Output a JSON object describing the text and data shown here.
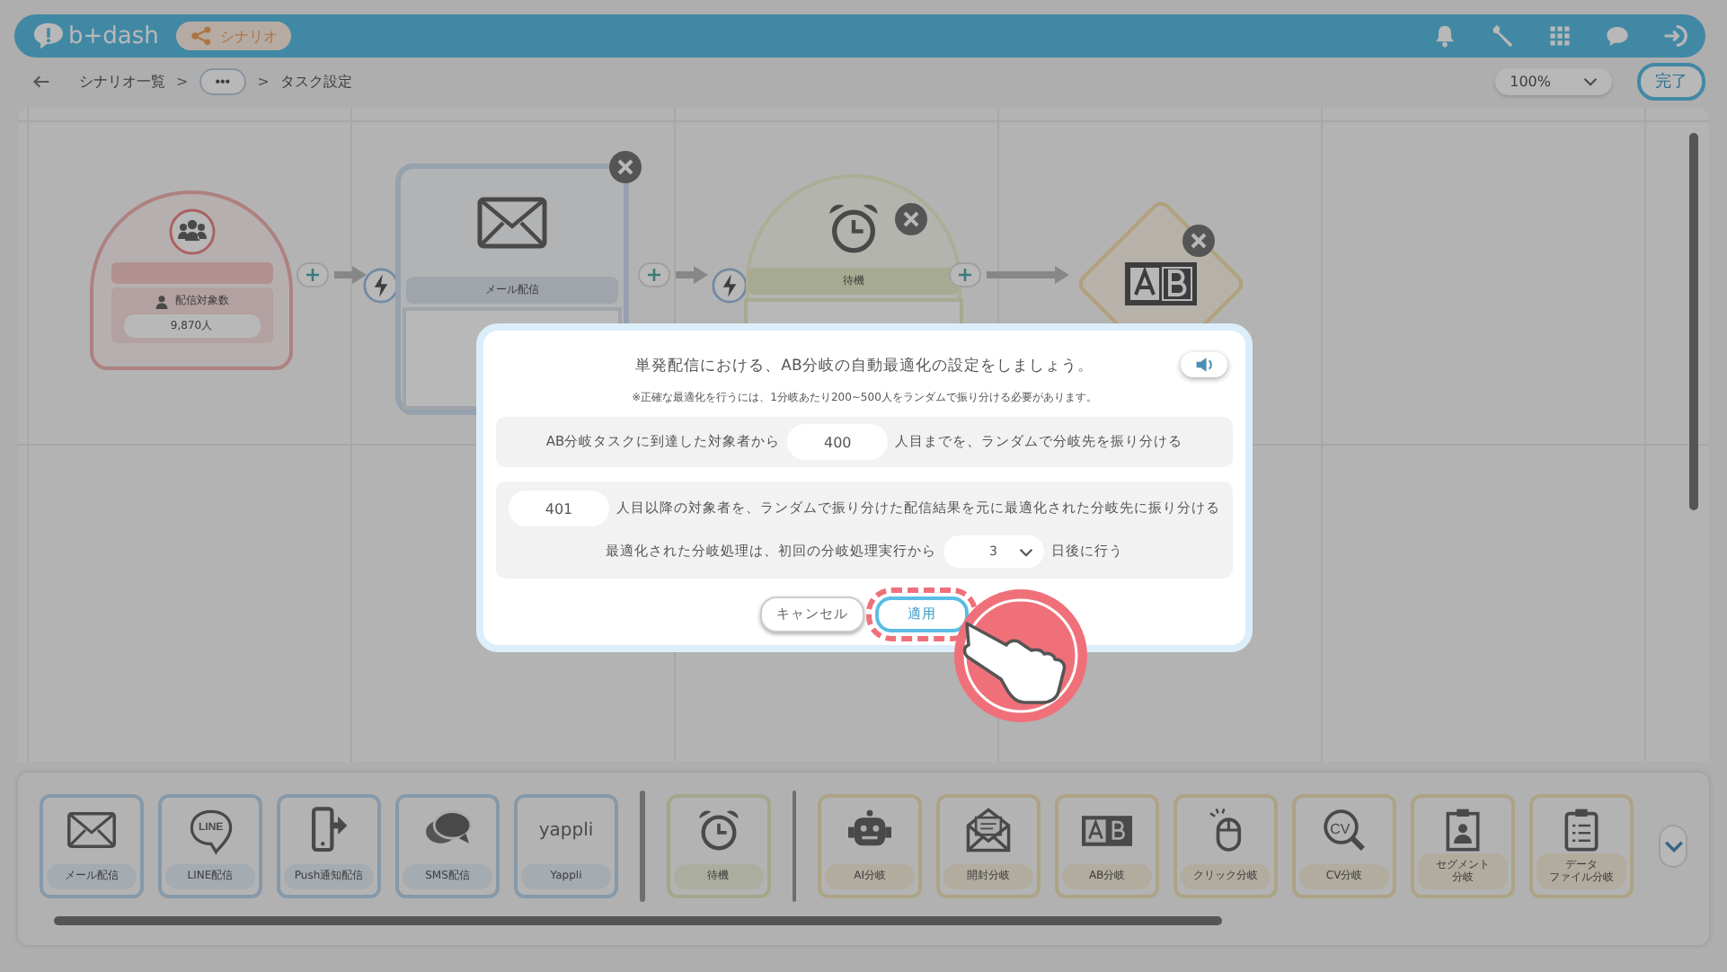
{
  "header": {
    "logo": "b+dash",
    "app_badge": "シナリオ"
  },
  "breadcrumb": {
    "separator": ">",
    "items": [
      {
        "label": "シナリオ一覧",
        "kind": "link"
      },
      {
        "label": "•••",
        "kind": "more"
      },
      {
        "label": "タスク設定",
        "kind": "current"
      }
    ]
  },
  "zoom_select": {
    "value": "100%"
  },
  "done_button": "完了",
  "canvas_nodes": [
    {
      "kind": "start",
      "label": "配信対象数",
      "count": "9,870人"
    },
    {
      "kind": "mail",
      "label": "メール配信"
    },
    {
      "kind": "wait",
      "label": "待機"
    },
    {
      "kind": "ab"
    }
  ],
  "modal": {
    "title": "単発配信における、AB分岐の自動最適化の設定をしましょう。",
    "note": "※正確な最適化を行うには、1分岐あたり200~500人をランダムで振り分ける必要があります。",
    "random_row": {
      "prefix": "AB分岐タスクに到達した対象者から",
      "value": "400",
      "suffix": "人目までを、ランダムで分岐先を振り分ける"
    },
    "optimize_row": {
      "value": "401",
      "suffix": "人目以降の対象者を、ランダムで振り分けた配信結果を元に最適化された分岐先に振り分ける"
    },
    "delay_row": {
      "prefix": "最適化された分岐処理は、初回の分岐処理実行から",
      "value": "3",
      "suffix": "日後に行う"
    },
    "buttons": [
      {
        "label": "キャンセル",
        "kind": "secondary",
        "highlighted": false
      },
      {
        "label": "適用",
        "kind": "primary",
        "highlighted": true
      }
    ]
  },
  "palette": {
    "groups": [
      {
        "kind": "delivery",
        "items": [
          {
            "label": "メール配信",
            "kind": "mail"
          },
          {
            "label": "LINE配信",
            "kind": "line",
            "icon_text": "LINE"
          },
          {
            "label": "Push通知配信",
            "kind": "push"
          },
          {
            "label": "SMS配信",
            "kind": "sms"
          },
          {
            "label": "Yappli",
            "kind": "yappli",
            "logo": "yappli"
          }
        ]
      },
      {
        "kind": "wait",
        "items": [
          {
            "label": "待機",
            "kind": "alarm"
          }
        ]
      },
      {
        "kind": "branch",
        "items": [
          {
            "label": "AI分岐",
            "kind": "robot"
          },
          {
            "label": "開封分岐",
            "kind": "open"
          },
          {
            "label": "AB分岐",
            "kind": "ab"
          },
          {
            "label": "クリック分岐",
            "kind": "mouse"
          },
          {
            "label": "CV分岐",
            "kind": "cv",
            "icon_text": "CV"
          },
          {
            "label_lines": [
              "セグメント",
              "分岐"
            ],
            "kind": "badge"
          },
          {
            "label_lines": [
              "データ",
              "ファイル分岐"
            ],
            "kind": "clipboard"
          }
        ]
      }
    ]
  }
}
